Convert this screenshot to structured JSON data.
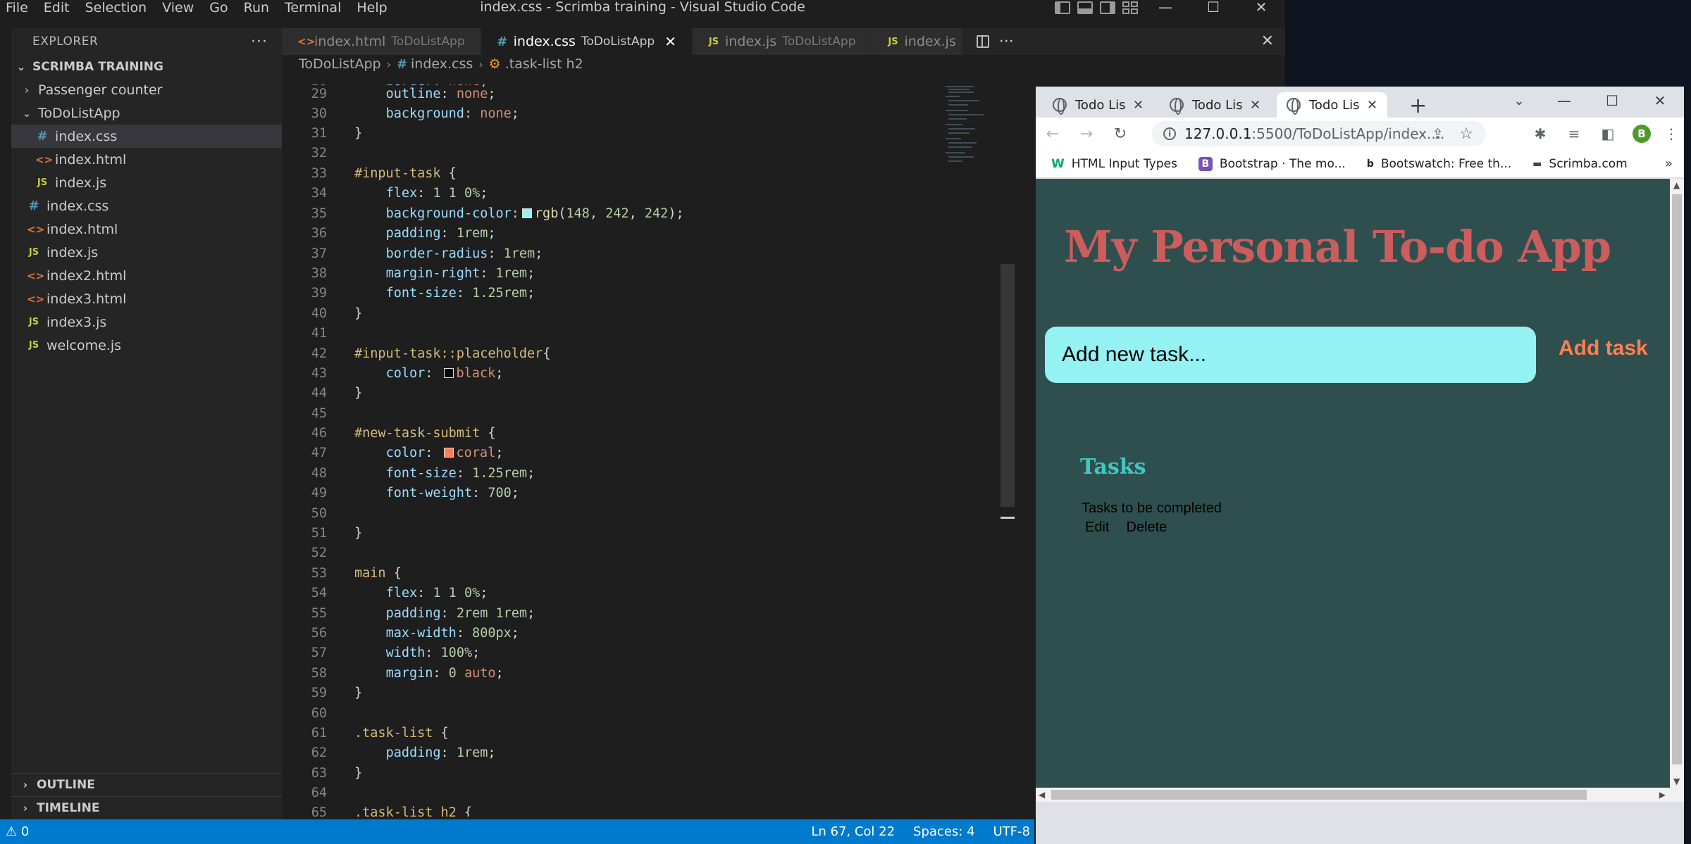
{
  "vscode": {
    "menu": [
      "File",
      "Edit",
      "Selection",
      "View",
      "Go",
      "Run",
      "Terminal",
      "Help"
    ],
    "window_title": "index.css - Scrimba training - Visual Studio Code",
    "sidebar": {
      "header": "EXPLORER",
      "more": "···",
      "root": "SCRIMBA TRAINING",
      "items": [
        {
          "label": "Passenger counter",
          "kind": "folder",
          "expanded": false
        },
        {
          "label": "ToDoListApp",
          "kind": "folder",
          "expanded": true
        },
        {
          "label": "index.css",
          "kind": "css"
        },
        {
          "label": "index.html",
          "kind": "html"
        },
        {
          "label": "index.js",
          "kind": "js"
        },
        {
          "label": "index.css",
          "kind": "css"
        },
        {
          "label": "index.html",
          "kind": "html"
        },
        {
          "label": "index.js",
          "kind": "js"
        },
        {
          "label": "index2.html",
          "kind": "html"
        },
        {
          "label": "index3.html",
          "kind": "html"
        },
        {
          "label": "index3.js",
          "kind": "js"
        },
        {
          "label": "welcome.js",
          "kind": "js"
        }
      ],
      "outline": "OUTLINE",
      "timeline": "TIMELINE"
    },
    "tabs": [
      {
        "name": "index.html",
        "path": "ToDoListApp",
        "kind": "html"
      },
      {
        "name": "index.css",
        "path": "ToDoListApp",
        "kind": "css",
        "active": true
      },
      {
        "name": "index.js",
        "path": "ToDoListApp",
        "kind": "js"
      },
      {
        "name": "index.js",
        "path": "",
        "kind": "js"
      }
    ],
    "breadcrumb": {
      "folder": "ToDoListApp",
      "file": "index.css",
      "symbol": ".task-list h2"
    },
    "icons": {
      "css": "#",
      "html": "<>",
      "js": "JS",
      "close": "✕",
      "chevron_right": "›",
      "chevron_down": "⌄"
    },
    "status": {
      "problems": "⚠ 0",
      "position": "Ln 67, Col 22",
      "spaces": "Spaces: 4",
      "encoding": "UTF-8"
    }
  },
  "chrome": {
    "tabs": [
      {
        "title": "Todo List"
      },
      {
        "title": "Todo List"
      },
      {
        "title": "Todo List",
        "active": true
      }
    ],
    "url_host": "127.0.0.1",
    "url_rest": ":5500/ToDoListApp/index....",
    "bookmarks": [
      {
        "label": "HTML Input Types",
        "icon": "W"
      },
      {
        "label": "Bootstrap · The mo...",
        "icon": "B"
      },
      {
        "label": "Bootswatch: Free th...",
        "icon": "b"
      },
      {
        "label": "Scrimba.com",
        "icon": "▬"
      }
    ],
    "bookmarks_more": "»",
    "profile_initial": "B",
    "page": {
      "title": "My Personal To-do App",
      "input_placeholder": "Add new task...",
      "add_button": "Add task",
      "tasks_heading": "Tasks",
      "task_text": "Tasks to be completed",
      "edit_label": "Edit",
      "delete_label": "Delete"
    },
    "colors": {
      "page_bg": "#2f4f4f",
      "title": "#cd5c5c",
      "input_bg": "#94f2f2",
      "button": "#ff7f50"
    }
  }
}
